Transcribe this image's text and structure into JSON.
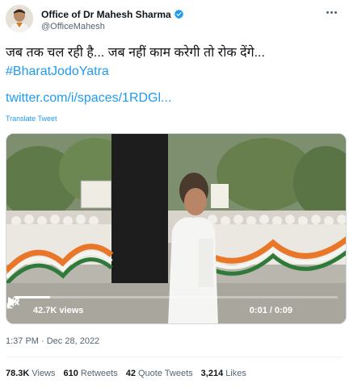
{
  "author": {
    "display_name": "Office of Dr Mahesh Sharma",
    "handle": "@OfficeMahesh",
    "verified_icon": "verified-badge-icon",
    "more_icon": "more-options-icon"
  },
  "tweet": {
    "text_line": "जब तक चल रही है... जब नहीं काम करेगी तो रोक देंगे...",
    "hashtag": "#BharatJodoYatra",
    "url": "twitter.com/i/spaces/1RDGl...",
    "translate_label": "Translate Tweet",
    "timestamp": "1:37 PM · Dec 28, 2022"
  },
  "video": {
    "views": "42.7K views",
    "time": "0:01 / 0:09",
    "progress": 0.11,
    "play_icon": "play-icon",
    "volume_icon": "volume-icon",
    "fullscreen_icon": "fullscreen-icon"
  },
  "stats": [
    {
      "value": "78.3K",
      "label": "Views"
    },
    {
      "value": "610",
      "label": "Retweets"
    },
    {
      "value": "42",
      "label": "Quote Tweets"
    },
    {
      "value": "3,214",
      "label": "Likes"
    }
  ],
  "colors": {
    "link": "#1d9bf0",
    "secondary_text": "#536471",
    "primary_text": "#0f1419"
  }
}
